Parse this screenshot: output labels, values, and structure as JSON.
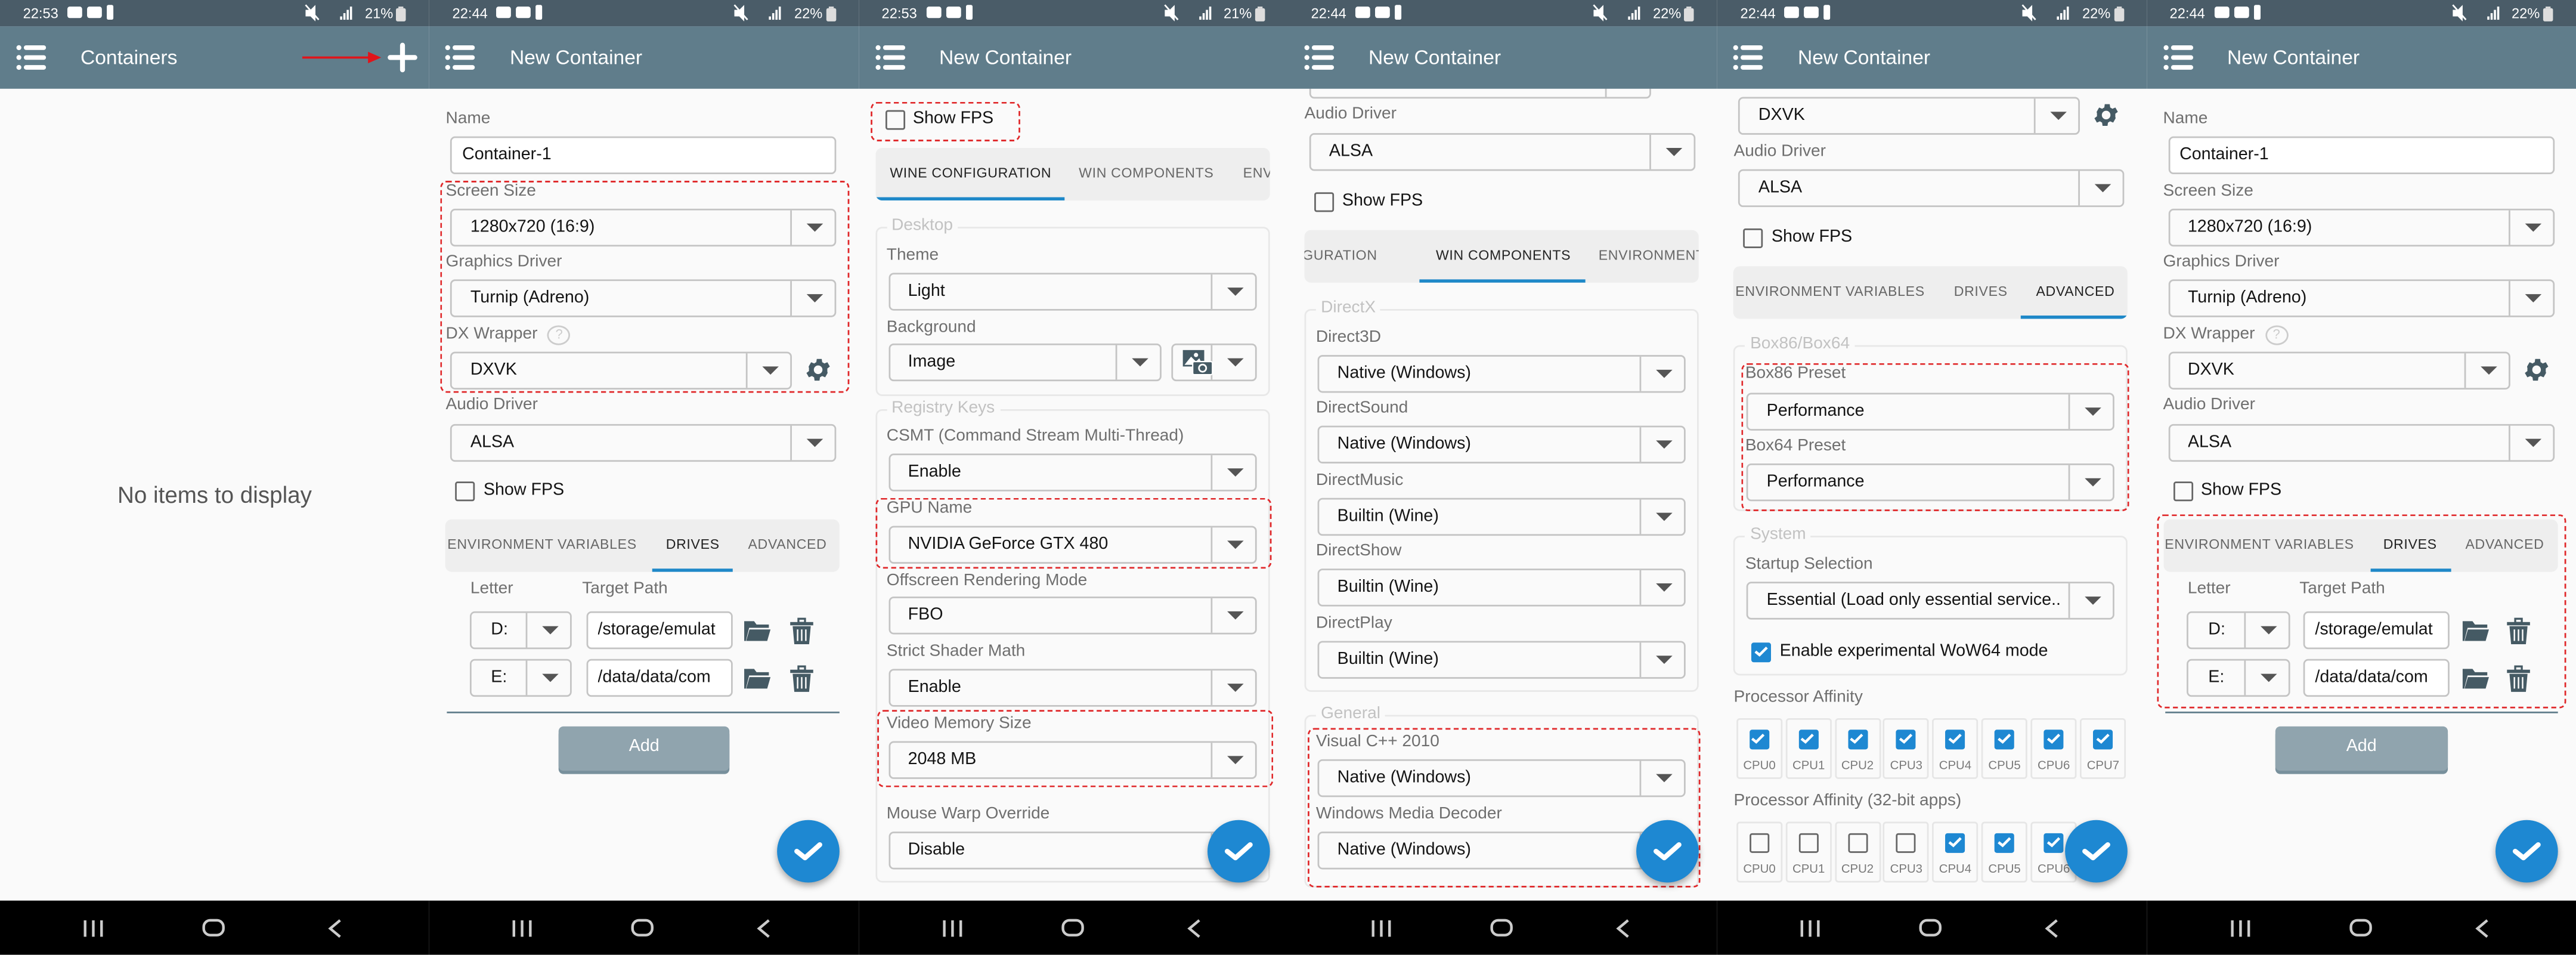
{
  "colors": {
    "status_bar": "#4a5c68",
    "app_bar": "#607d8b",
    "accent": "#1e88d2",
    "annotation_red": "#e0282a",
    "add_button": "#90a4ae",
    "icon": "#455a64"
  },
  "panels": [
    {
      "status": {
        "time": "22:53",
        "battery": "21%",
        "icons": [
          "youtube-icon",
          "notification-icon",
          "mute-icon",
          "wifi-icon",
          "signal-icon",
          "battery-icon"
        ]
      },
      "header": {
        "title": "Containers",
        "menu_icon": "hamburger-menu-icon",
        "action_icon": "plus-icon"
      },
      "empty_message": "No items to display",
      "annotation": "red-arrow-pointing-to-plus"
    },
    {
      "status": {
        "time": "22:44",
        "battery": "22%"
      },
      "header": {
        "title": "New Container"
      },
      "fields": {
        "name": {
          "label": "Name",
          "value": "Container-1"
        },
        "screen_size": {
          "label": "Screen Size",
          "value": "1280x720 (16:9)"
        },
        "graphics_driver": {
          "label": "Graphics Driver",
          "value": "Turnip (Adreno)"
        },
        "dx_wrapper": {
          "label": "DX Wrapper",
          "value": "DXVK",
          "help": "?"
        },
        "audio_driver": {
          "label": "Audio Driver",
          "value": "ALSA"
        },
        "show_fps": {
          "label": "Show FPS",
          "checked": false
        },
        "tabs": [
          "ENVIRONMENT VARIABLES",
          "DRIVES",
          "ADVANCED"
        ],
        "active_tab": "DRIVES",
        "drives": {
          "letter_header": "Letter",
          "path_header": "Target Path",
          "rows": [
            {
              "letter": "D:",
              "path": "/storage/emulat"
            },
            {
              "letter": "E:",
              "path": "/data/data/com"
            }
          ]
        },
        "add_button": "Add"
      }
    },
    {
      "status": {
        "time": "22:53",
        "battery": "21%"
      },
      "header": {
        "title": "New Container"
      },
      "fields": {
        "show_fps": {
          "label": "Show FPS",
          "checked": false
        },
        "tabs": [
          "WINE CONFIGURATION",
          "WIN COMPONENTS",
          "ENVIRONMENT VARIABLES"
        ],
        "active_tab": "WINE CONFIGURATION",
        "desktop": {
          "legend": "Desktop",
          "theme": {
            "label": "Theme",
            "value": "Light"
          },
          "background": {
            "label": "Background",
            "value": "Image"
          }
        },
        "registry": {
          "legend": "Registry Keys",
          "csmt": {
            "label": "CSMT (Command Stream Multi-Thread)",
            "value": "Enable"
          },
          "gpu_name": {
            "label": "GPU Name",
            "value": "NVIDIA GeForce GTX 480"
          },
          "offscreen": {
            "label": "Offscreen Rendering Mode",
            "value": "FBO"
          },
          "strict_shader": {
            "label": "Strict Shader Math",
            "value": "Enable"
          },
          "video_memory": {
            "label": "Video Memory Size",
            "value": "2048 MB"
          },
          "mouse_warp": {
            "label": "Mouse Warp Override",
            "value": "Disable"
          }
        }
      }
    },
    {
      "status": {
        "time": "22:44",
        "battery": "22%"
      },
      "header": {
        "title": "New Container"
      },
      "fields": {
        "audio_driver": {
          "label": "Audio Driver",
          "value": "ALSA"
        },
        "show_fps": {
          "label": "Show FPS",
          "checked": false
        },
        "tabs": [
          "WINE CONFIGURATION",
          "WIN COMPONENTS",
          "ENVIRONMENT VARIABLES"
        ],
        "active_tab": "WIN COMPONENTS",
        "directx": {
          "legend": "DirectX",
          "direct3d": {
            "label": "Direct3D",
            "value": "Native (Windows)"
          },
          "directsound": {
            "label": "DirectSound",
            "value": "Native (Windows)"
          },
          "directmusic": {
            "label": "DirectMusic",
            "value": "Builtin (Wine)"
          },
          "directshow": {
            "label": "DirectShow",
            "value": "Builtin (Wine)"
          },
          "directplay": {
            "label": "DirectPlay",
            "value": "Builtin (Wine)"
          }
        },
        "general": {
          "legend": "General",
          "vcpp2010": {
            "label": "Visual C++ 2010",
            "value": "Native (Windows)"
          },
          "wmd": {
            "label": "Windows Media Decoder",
            "value": "Native (Windows)"
          }
        }
      }
    },
    {
      "status": {
        "time": "22:44",
        "battery": "22%"
      },
      "header": {
        "title": "New Container"
      },
      "fields": {
        "dx_wrapper": {
          "value": "DXVK"
        },
        "audio_driver": {
          "label": "Audio Driver",
          "value": "ALSA"
        },
        "show_fps": {
          "label": "Show FPS",
          "checked": false
        },
        "tabs": [
          "ENVIRONMENT VARIABLES",
          "DRIVES",
          "ADVANCED"
        ],
        "active_tab": "ADVANCED",
        "box": {
          "legend": "Box86/Box64",
          "box86_preset": {
            "label": "Box86 Preset",
            "value": "Performance"
          },
          "box64_preset": {
            "label": "Box64 Preset",
            "value": "Performance"
          }
        },
        "system": {
          "legend": "System",
          "startup": {
            "label": "Startup Selection",
            "value": "Essential (Load only essential service.."
          },
          "wow64": {
            "label": "Enable experimental WoW64 mode",
            "checked": true
          }
        },
        "affinity": {
          "label": "Processor Affinity",
          "cpus": [
            {
              "name": "CPU0",
              "checked": true
            },
            {
              "name": "CPU1",
              "checked": true
            },
            {
              "name": "CPU2",
              "checked": true
            },
            {
              "name": "CPU3",
              "checked": true
            },
            {
              "name": "CPU4",
              "checked": true
            },
            {
              "name": "CPU5",
              "checked": true
            },
            {
              "name": "CPU6",
              "checked": true
            },
            {
              "name": "CPU7",
              "checked": true
            }
          ]
        },
        "affinity32": {
          "label": "Processor Affinity (32-bit apps)",
          "cpus": [
            {
              "name": "CPU0",
              "checked": false
            },
            {
              "name": "CPU1",
              "checked": false
            },
            {
              "name": "CPU2",
              "checked": false
            },
            {
              "name": "CPU3",
              "checked": false
            },
            {
              "name": "CPU4",
              "checked": true
            },
            {
              "name": "CPU5",
              "checked": true
            },
            {
              "name": "CPU6",
              "checked": true
            }
          ]
        }
      }
    },
    {
      "status": {
        "time": "22:44",
        "battery": "22%"
      },
      "header": {
        "title": "New Container"
      },
      "fields": {
        "name": {
          "label": "Name",
          "value": "Container-1"
        },
        "screen_size": {
          "label": "Screen Size",
          "value": "1280x720 (16:9)"
        },
        "graphics_driver": {
          "label": "Graphics Driver",
          "value": "Turnip (Adreno)"
        },
        "dx_wrapper": {
          "label": "DX Wrapper",
          "value": "DXVK",
          "help": "?"
        },
        "audio_driver": {
          "label": "Audio Driver",
          "value": "ALSA"
        },
        "show_fps": {
          "label": "Show FPS",
          "checked": false
        },
        "tabs": [
          "ENVIRONMENT VARIABLES",
          "DRIVES",
          "ADVANCED"
        ],
        "active_tab": "DRIVES",
        "drives": {
          "letter_header": "Letter",
          "path_header": "Target Path",
          "rows": [
            {
              "letter": "D:",
              "path": "/storage/emulat"
            },
            {
              "letter": "E:",
              "path": "/data/data/com"
            }
          ]
        },
        "add_button": "Add"
      }
    }
  ]
}
